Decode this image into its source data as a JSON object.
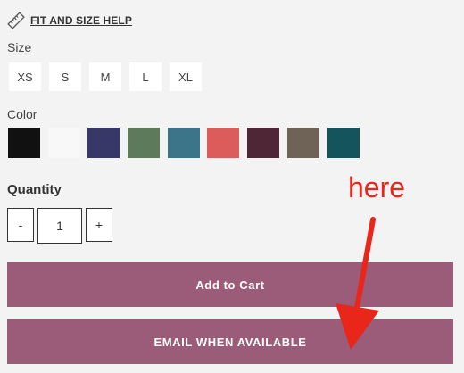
{
  "fit_help": {
    "label": "FIT AND SIZE HELP",
    "icon": "ruler-icon"
  },
  "size": {
    "label": "Size",
    "options": [
      "XS",
      "S",
      "M",
      "L",
      "XL"
    ]
  },
  "color": {
    "label": "Color",
    "swatches": [
      {
        "name": "black",
        "hex": "#111111"
      },
      {
        "name": "white",
        "hex": "#f8f8f8"
      },
      {
        "name": "navy",
        "hex": "#373868"
      },
      {
        "name": "olive",
        "hex": "#5d7a5a"
      },
      {
        "name": "teal-blue",
        "hex": "#3c7589"
      },
      {
        "name": "coral",
        "hex": "#db5c5a"
      },
      {
        "name": "burgundy",
        "hex": "#4f2636"
      },
      {
        "name": "taupe",
        "hex": "#6e6356"
      },
      {
        "name": "dark-teal",
        "hex": "#14545d"
      }
    ]
  },
  "quantity": {
    "label": "Quantity",
    "minus": "-",
    "value": "1",
    "plus": "+"
  },
  "buttons": {
    "add_to_cart": "Add to Cart",
    "email_when_available": "EMAIL WHEN AVAILABLE"
  },
  "annotation": {
    "text": "here",
    "color": "#e8261a"
  },
  "colors": {
    "accent": "#9a5c79",
    "background": "#f4f3f4"
  }
}
